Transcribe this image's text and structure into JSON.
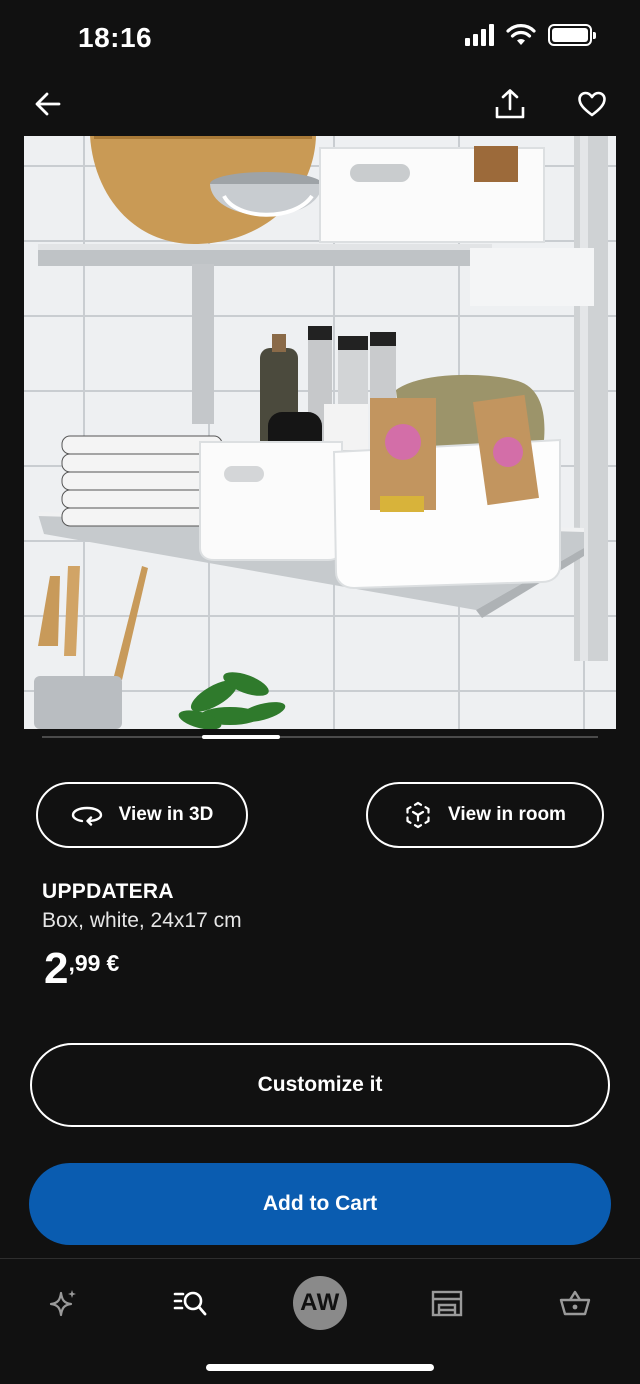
{
  "status_bar": {
    "time": "18:16",
    "icons": [
      "cellular-signal-icon",
      "wifi-icon",
      "battery-icon"
    ]
  },
  "top_nav": {
    "back_icon": "arrow-left-icon",
    "share_icon": "share-icon",
    "favorite_icon": "heart-icon"
  },
  "hero_image": {
    "description_icon": "product-photo",
    "carousel_position": 1
  },
  "view_buttons": {
    "view_3d_label": "View in 3D",
    "view_3d_icon": "rotate-3d-icon",
    "view_room_label": "View in room",
    "view_room_icon": "ar-cube-icon"
  },
  "product": {
    "name": "UPPDATERA",
    "description": "Box, white, 24x17 cm",
    "price_integer": "2",
    "price_decimal": ",99",
    "price_currency": "€"
  },
  "actions": {
    "customize_label": "Customize it",
    "add_to_cart_label": "Add to Cart"
  },
  "tab_bar": {
    "tabs": [
      {
        "name": "inspiration",
        "icon": "sparkle-icon"
      },
      {
        "name": "search",
        "icon": "search-list-icon"
      },
      {
        "name": "profile",
        "initials": "AW"
      },
      {
        "name": "store",
        "icon": "store-icon"
      },
      {
        "name": "cart",
        "icon": "basket-icon"
      }
    ]
  },
  "colors": {
    "background": "#111111",
    "primary_button": "#0a5cb0",
    "text": "#ffffff",
    "avatar": "#8a8a8a"
  }
}
